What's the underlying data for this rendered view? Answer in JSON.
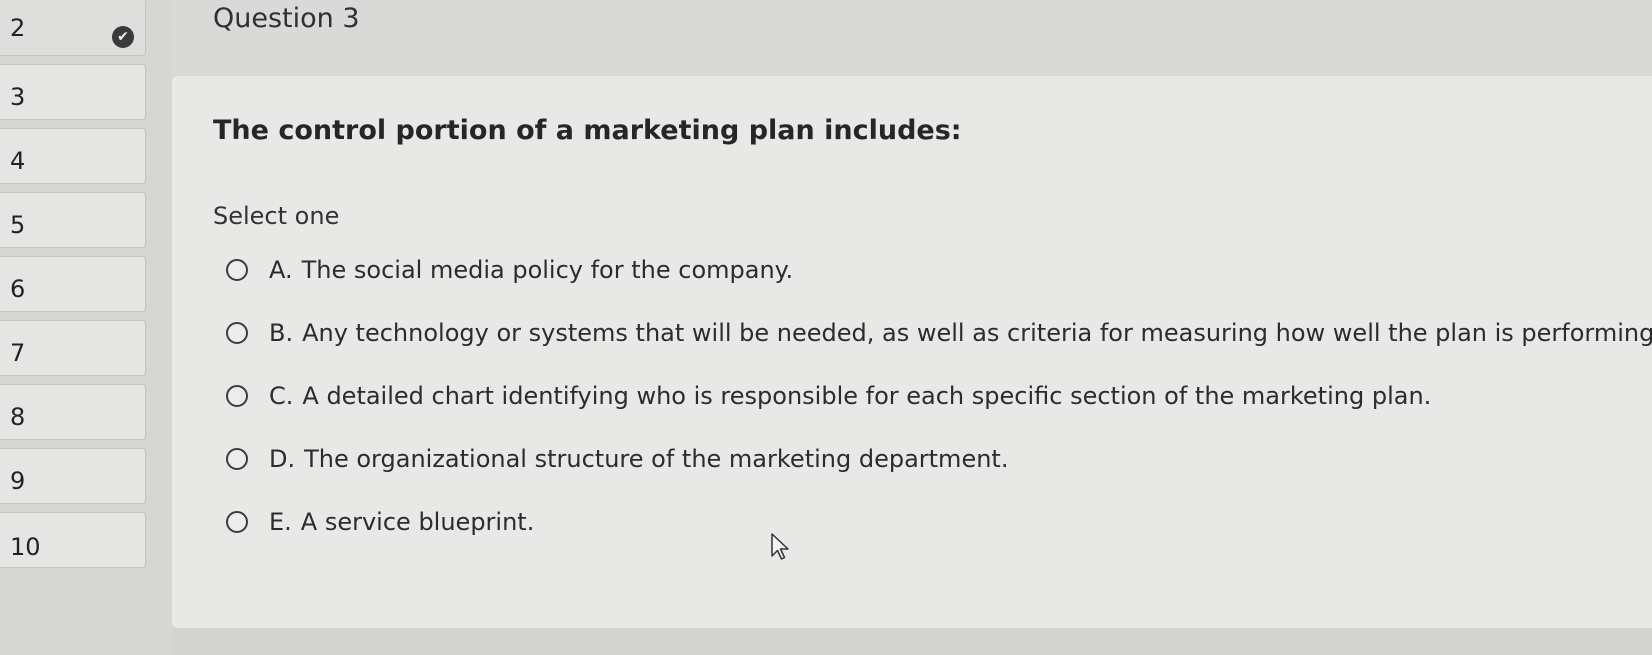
{
  "nav": {
    "items": [
      {
        "number": "2",
        "answered": true
      },
      {
        "number": "3",
        "answered": false
      },
      {
        "number": "4",
        "answered": false
      },
      {
        "number": "5",
        "answered": false
      },
      {
        "number": "6",
        "answered": false
      },
      {
        "number": "7",
        "answered": false
      },
      {
        "number": "8",
        "answered": false
      },
      {
        "number": "9",
        "answered": false
      },
      {
        "number": "10",
        "answered": false
      }
    ],
    "check_icon": "check-circle-icon"
  },
  "question": {
    "title": "Question 3",
    "text": "The control portion of a marketing plan includes:",
    "instruction": "Select one",
    "options": [
      {
        "letter": "A.",
        "text": "The social media policy for the company.",
        "selected": false
      },
      {
        "letter": "B.",
        "text": "Any technology or systems that will be needed, as well as criteria for measuring how well the plan is performing.",
        "selected": false
      },
      {
        "letter": "C.",
        "text": "A detailed chart identifying who is responsible for each specific section of the marketing plan.",
        "selected": false
      },
      {
        "letter": "D.",
        "text": "The organizational structure of the marketing department.",
        "selected": false
      },
      {
        "letter": "E.",
        "text": "A service blueprint.",
        "selected": false
      }
    ]
  },
  "colors": {
    "background": "#d6d6d4",
    "card": "#e8e8e6",
    "text": "#2a2a2a"
  }
}
